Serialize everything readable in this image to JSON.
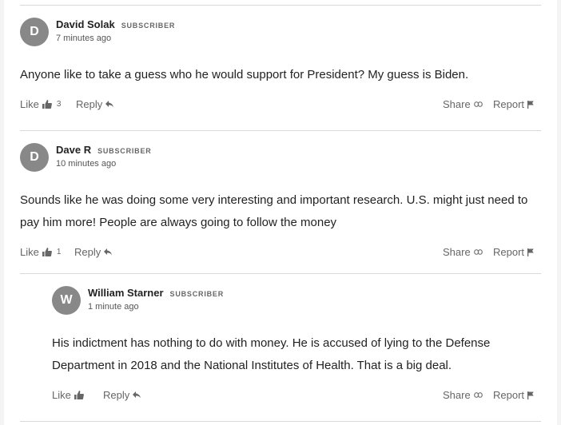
{
  "actions": {
    "like_label": "Like",
    "reply_label": "Reply",
    "share_label": "Share",
    "report_label": "Report"
  },
  "comments": [
    {
      "avatar_initial": "D",
      "author": "David Solak",
      "badge": "SUBSCRIBER",
      "time": "7 minutes ago",
      "text": "Anyone like to take a guess who he would support for President? My guess is Biden.",
      "likes": "3"
    },
    {
      "avatar_initial": "D",
      "author": "Dave R",
      "badge": "SUBSCRIBER",
      "time": "10 minutes ago",
      "text": "Sounds like he was doing some very interesting and important research.  U.S. might just need to pay him more!  People are always going to follow the money",
      "likes": "1"
    },
    {
      "avatar_initial": "W",
      "author": "William Starner",
      "badge": "SUBSCRIBER",
      "time": "1 minute ago",
      "text": "His indictment has nothing to do with money.  He is accused of lying to the Defense Department in 2018 and the National Institutes of Health. That is a big deal.",
      "likes": ""
    }
  ],
  "colors": {
    "avatar": "#888888",
    "divider": "#d9d9d9",
    "text": "#222222",
    "muted": "#666666"
  }
}
